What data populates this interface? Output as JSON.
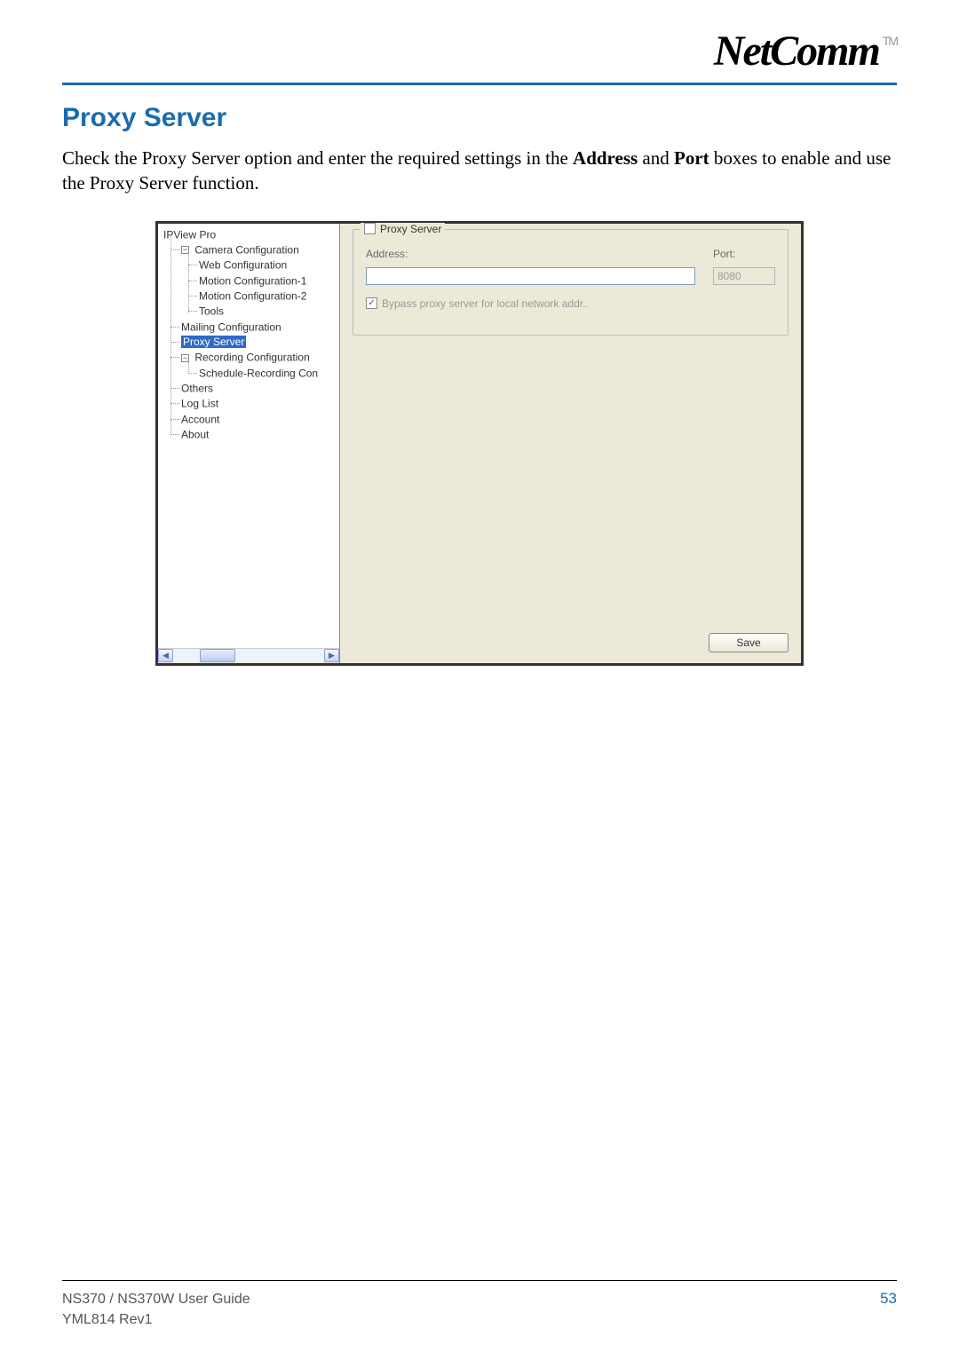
{
  "logo": {
    "text": "NetComm",
    "tm": "TM"
  },
  "section_title": "Proxy Server",
  "intro": {
    "pre": "Check the Proxy Server option and enter the required settings in the ",
    "b1": "Address",
    "mid": " and ",
    "b2": "Port",
    "post": " boxes to enable and use the Proxy Server function."
  },
  "tree": {
    "root": "IPView Pro",
    "cam": "Camera Configuration",
    "web": "Web Configuration",
    "mc1": "Motion Configuration-1",
    "mc2": "Motion Configuration-2",
    "tools": "Tools",
    "mail": "Mailing Configuration",
    "proxy": "Proxy Server",
    "rec": "Recording Configuration",
    "sched": "Schedule-Recording Con",
    "others": "Others",
    "log": "Log List",
    "account": "Account",
    "about": "About"
  },
  "panel": {
    "group_label": "Proxy Server",
    "address_label": "Address:",
    "port_label": "Port:",
    "address_value": "",
    "port_value": "8080",
    "bypass_label": "Bypass proxy server for local network addr..",
    "save_label": "Save"
  },
  "footer": {
    "guide": "NS370 / NS370W User Guide",
    "rev": "YML814 Rev1",
    "page": "53"
  }
}
